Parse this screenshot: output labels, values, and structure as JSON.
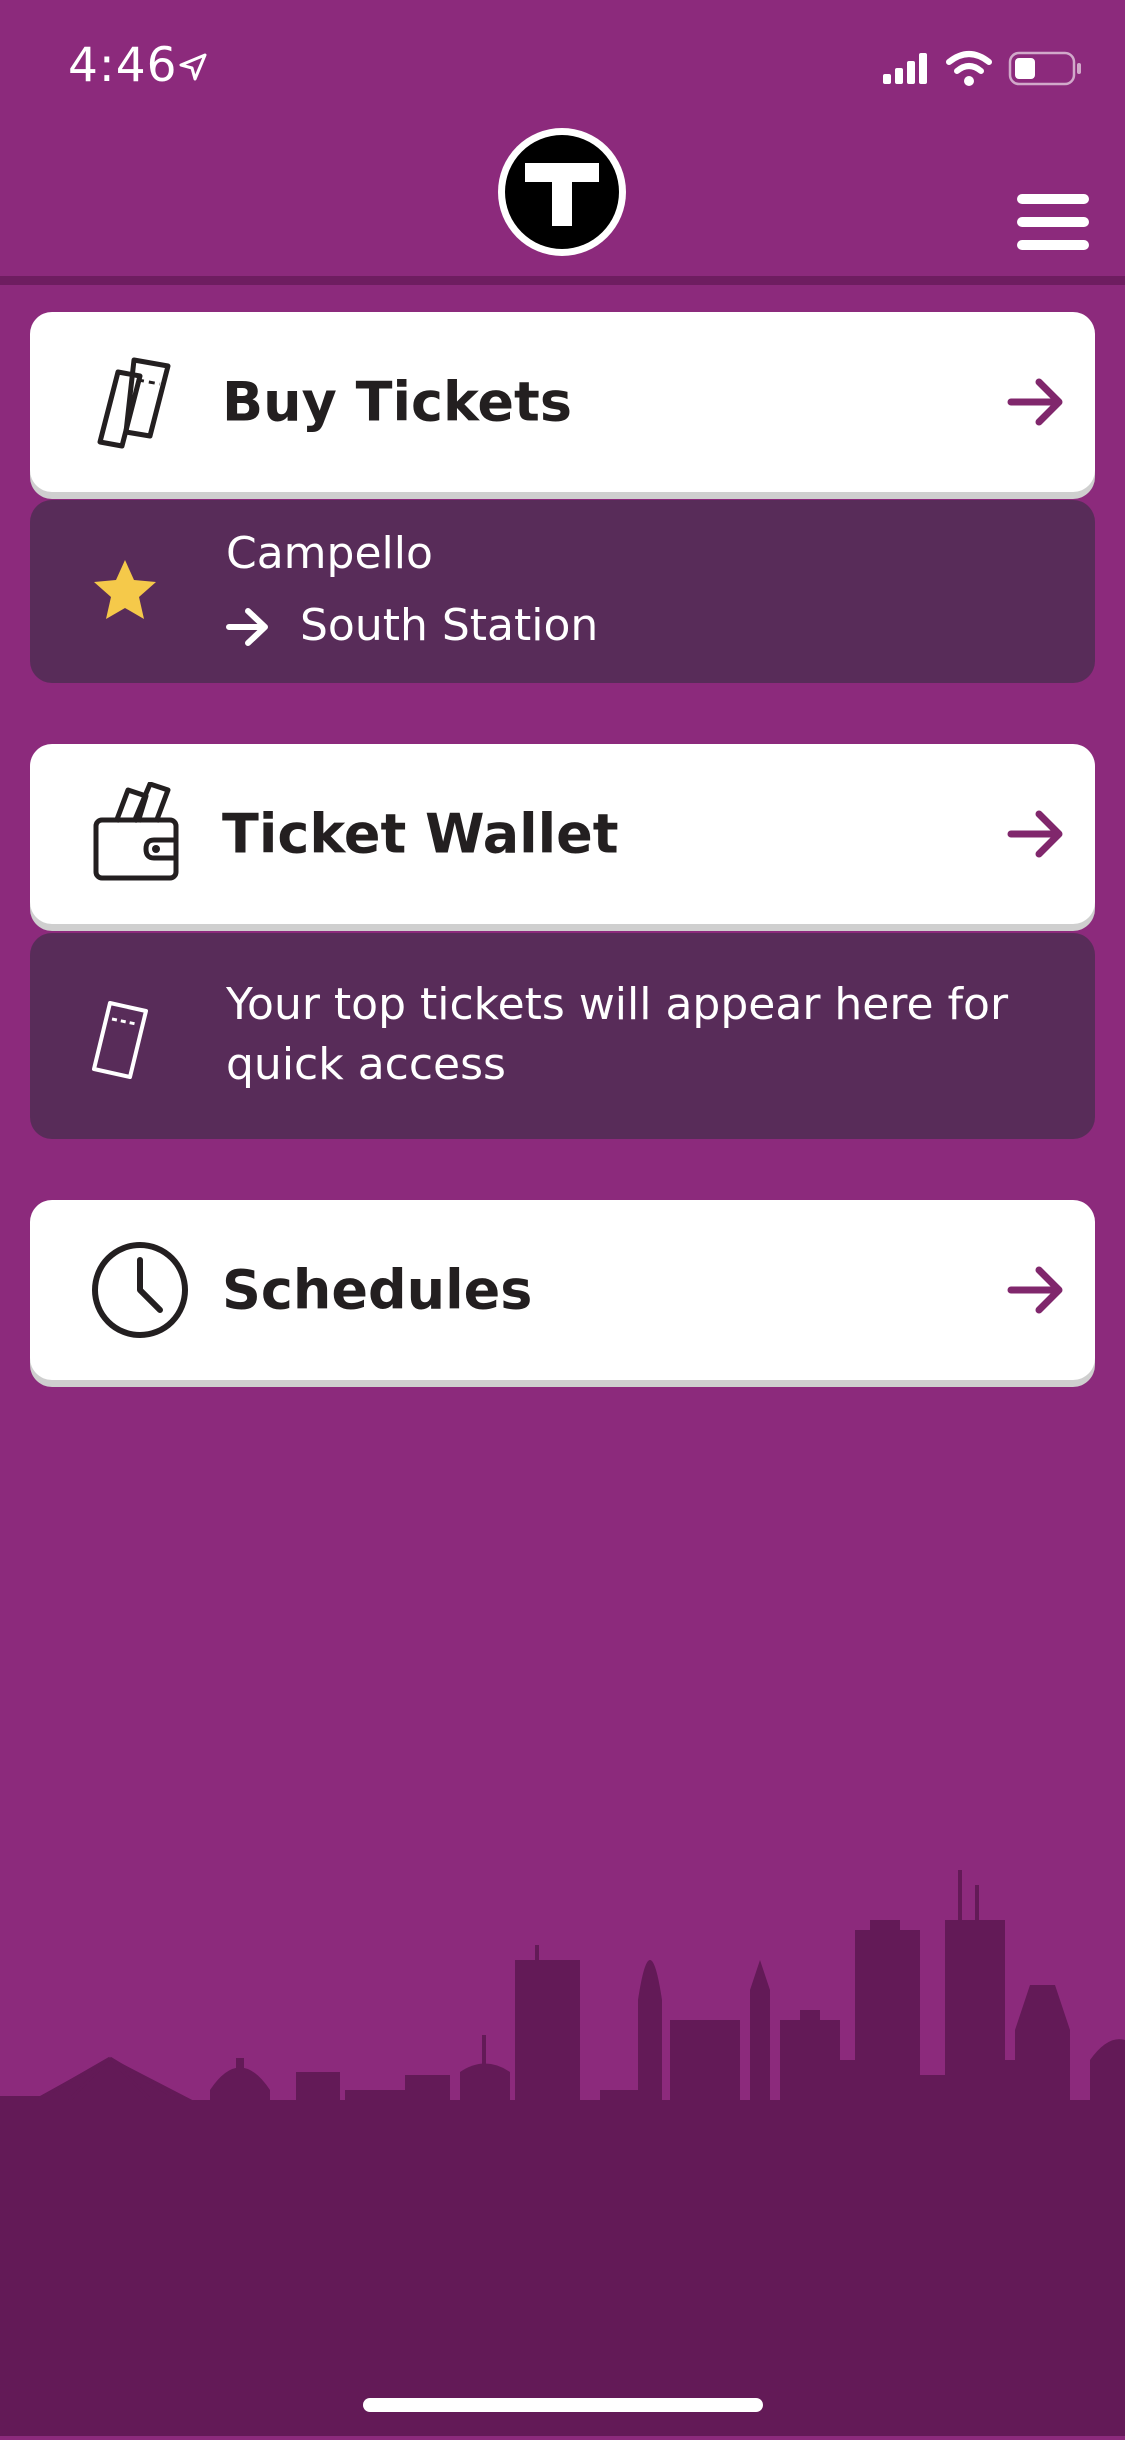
{
  "status_bar": {
    "time": "4:46",
    "location_icon": "location-arrow-icon",
    "signal_icon": "cellular-signal-icon",
    "wifi_icon": "wifi-icon",
    "battery_icon": "battery-icon"
  },
  "header": {
    "logo_letter": "T",
    "logo_icon": "mbta-t-logo",
    "menu_icon": "hamburger-menu-icon"
  },
  "menu_items": {
    "buy_tickets": "Buy Tickets",
    "ticket_wallet": "Ticket Wallet",
    "schedules": "Schedules"
  },
  "favorite_trip": {
    "origin": "Campello",
    "destination": "South Station",
    "star_icon": "star-icon",
    "arrow_icon": "arrow-right-icon"
  },
  "wallet_message": {
    "text": "Your top tickets will appear here for quick access",
    "icon": "ticket-icon"
  },
  "colors": {
    "background": "#8c2a7c",
    "panel": "#582c59",
    "card": "#ffffff",
    "accent": "#80276c",
    "star": "#f5c94a",
    "skyline": "#631a57"
  }
}
